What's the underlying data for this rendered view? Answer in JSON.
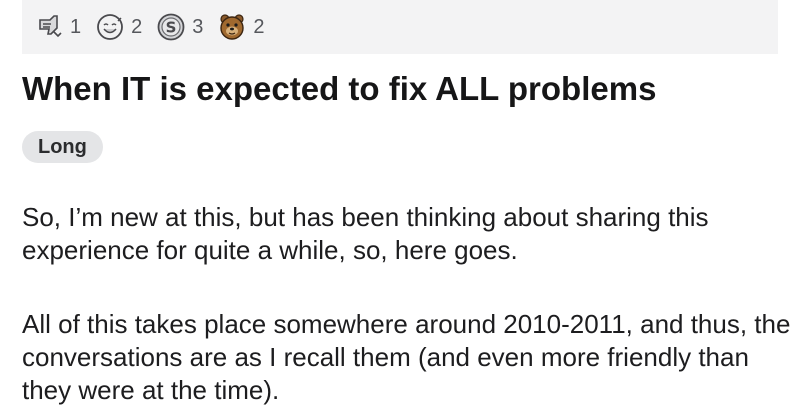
{
  "awards": [
    {
      "icon": "thumbs-down-award-icon",
      "count": "1"
    },
    {
      "icon": "wholesome-face-award-icon",
      "count": "2"
    },
    {
      "icon": "silver-coin-award-icon",
      "count": "3"
    },
    {
      "icon": "bear-award-icon",
      "count": "2"
    }
  ],
  "post": {
    "title": "When IT is expected to fix ALL problems",
    "flair": "Long",
    "paragraphs": [
      "So, I’m new at this, but has been thinking about sharing this experience for quite a while, so, here goes.",
      "All of this takes place somewhere around 2010-2011, and thus, the conversations are as I recall them (and even more friendly than they were at the time)."
    ]
  },
  "colors": {
    "awards_bar_bg": "#f3f3f4",
    "flair_bg": "#e4e5e7",
    "text": "#1d1d1f"
  }
}
